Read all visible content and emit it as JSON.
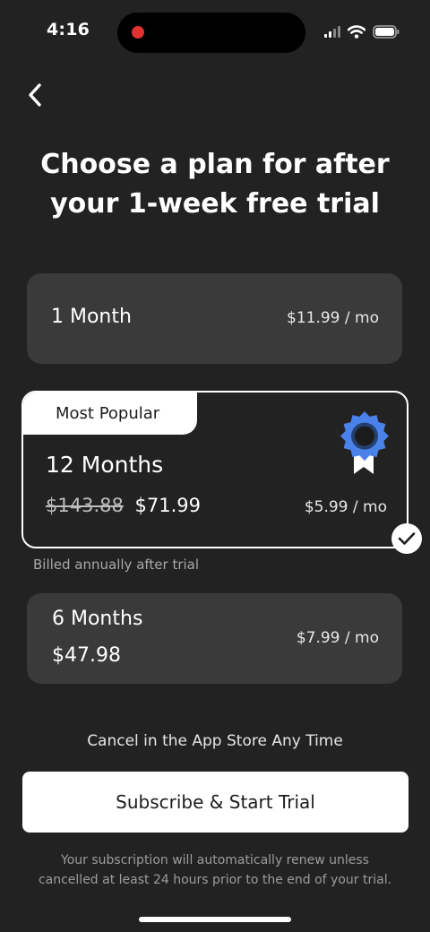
{
  "status_bar": {
    "time": "4:16",
    "icons": [
      "signal-icon",
      "wifi-icon",
      "battery-icon"
    ],
    "recording_color": "#e0322f"
  },
  "header": {
    "back_icon": "chevron-left-icon",
    "title_line1": "Choose a plan for after",
    "title_line2": "your 1-week free trial"
  },
  "plans": [
    {
      "label": "1 Month",
      "monthly_price": "$11.99 / mo"
    },
    {
      "badge": "Most Popular",
      "label": "12 Months",
      "original_price": "$143.88",
      "price": "$71.99",
      "monthly_price": "$5.99 / mo",
      "billing_note": "Billed annually after trial",
      "selected": true,
      "icon": "award-ribbon-icon"
    },
    {
      "label": "6 Months",
      "price": "$47.98",
      "monthly_price": "$7.99 / mo"
    }
  ],
  "cancel_note": "Cancel in the App Store Any Time",
  "cta_label": "Subscribe & Start Trial",
  "legal": {
    "line1": "Your subscription will automatically renew unless",
    "line2": "cancelled at least 24 hours prior to the end of your trial."
  },
  "colors": {
    "background": "#222222",
    "card": "#3a3a3a",
    "award_blue": "#4a82ea",
    "cta_background": "#ffffff"
  }
}
